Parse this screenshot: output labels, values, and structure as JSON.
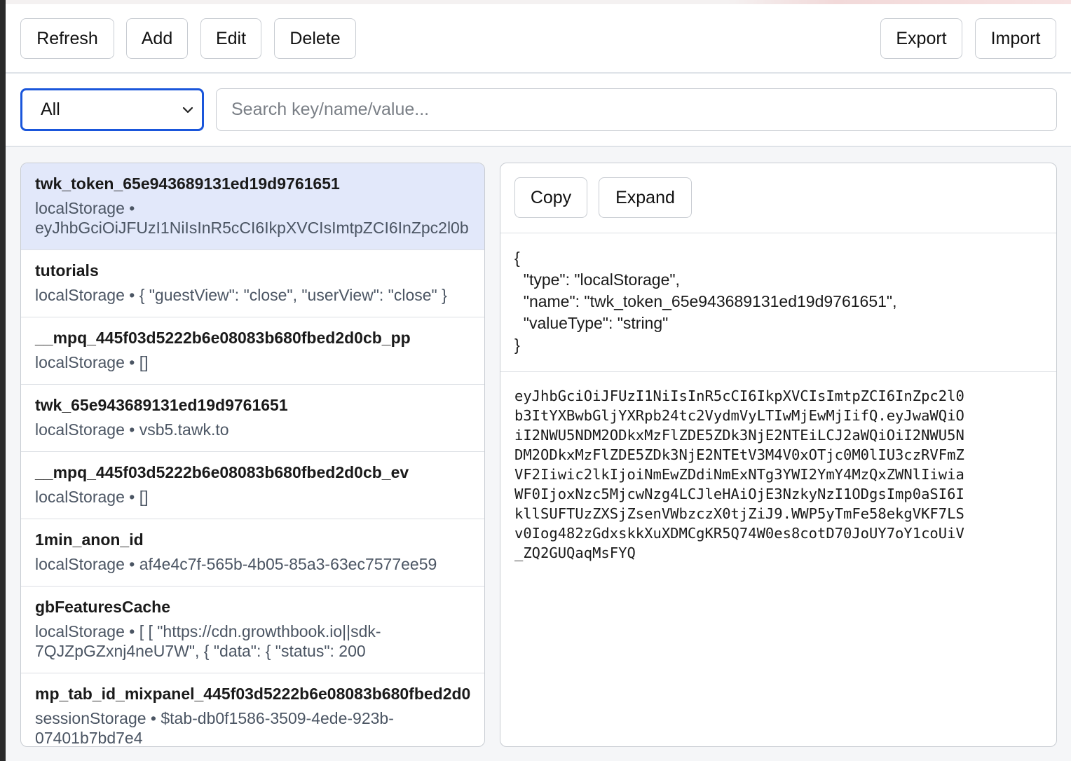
{
  "toolbar": {
    "refresh_label": "Refresh",
    "add_label": "Add",
    "edit_label": "Edit",
    "delete_label": "Delete",
    "export_label": "Export",
    "import_label": "Import"
  },
  "filter": {
    "selected": "All",
    "search_placeholder": "Search key/name/value..."
  },
  "items": [
    {
      "name": "twk_token_65e943689131ed19d9761651",
      "meta_line1": "localStorage •",
      "meta_line2": "eyJhbGciOiJFUzI1NiIsInR5cCI6IkpXVCIsImtpZCI6InZpc2l0b"
    },
    {
      "name": "tutorials",
      "meta_line1": "localStorage • { \"guestView\": \"close\", \"userView\": \"close\" }",
      "meta_line2": ""
    },
    {
      "name": "__mpq_445f03d5222b6e08083b680fbed2d0cb_pp",
      "meta_line1": "localStorage • []",
      "meta_line2": ""
    },
    {
      "name": "twk_65e943689131ed19d9761651",
      "meta_line1": "localStorage • vsb5.tawk.to",
      "meta_line2": ""
    },
    {
      "name": "__mpq_445f03d5222b6e08083b680fbed2d0cb_ev",
      "meta_line1": "localStorage • []",
      "meta_line2": ""
    },
    {
      "name": "1min_anon_id",
      "meta_line1": "localStorage • af4e4c7f-565b-4b05-85a3-63ec7577ee59",
      "meta_line2": ""
    },
    {
      "name": "gbFeaturesCache",
      "meta_line1": "localStorage • [ [ \"https://cdn.growthbook.io||sdk-",
      "meta_line2": "7QJZpGZxnj4neU7W\", { \"data\": { \"status\": 200"
    },
    {
      "name": "mp_tab_id_mixpanel_445f03d5222b6e08083b680fbed2d0",
      "meta_line1": "sessionStorage • $tab-db0f1586-3509-4ede-923b-",
      "meta_line2": "07401b7bd7e4"
    }
  ],
  "detail": {
    "copy_label": "Copy",
    "expand_label": "Expand",
    "json_lines": [
      "{",
      "  \"type\": \"localStorage\",",
      "  \"name\": \"twk_token_65e943689131ed19d9761651\",",
      "  \"valueType\": \"string\"",
      "}"
    ],
    "value_lines": [
      "eyJhbGciOiJFUzI1NiIsInR5cCI6IkpXVCIsImtpZCI6InZpc2l0",
      "b3ItYXBwbGljYXRpb24tc2VydmVyLTIwMjEwMjIifQ.eyJwaWQiO",
      "iI2NWU5NDM2ODkxMzFlZDE5ZDk3NjE2NTEiLCJ2aWQiOiI2NWU5N",
      "DM2ODkxMzFlZDE5ZDk3NjE2NTEtV3M4V0xOTjc0M0lIU3czRVFmZ",
      "VF2Iiwic2lkIjoiNmEwZDdiNmExNTg3YWI2YmY4MzQxZWNlIiwia",
      "WF0IjoxNzc5MjcwNzg4LCJleHAiOjE3NzkyNzI1ODgsImp0aSI6I",
      "kllSUFTUzZXSjZsenVWbzczX0tjZiJ9.WWP5yTmFe58ekgVKF7LS",
      "v0Iog482zGdxskkXuXDMCgKR5Q74W0es8cotD70JoUY7oY1coUiV",
      "_ZQ2GUQaqMsFYQ"
    ]
  }
}
